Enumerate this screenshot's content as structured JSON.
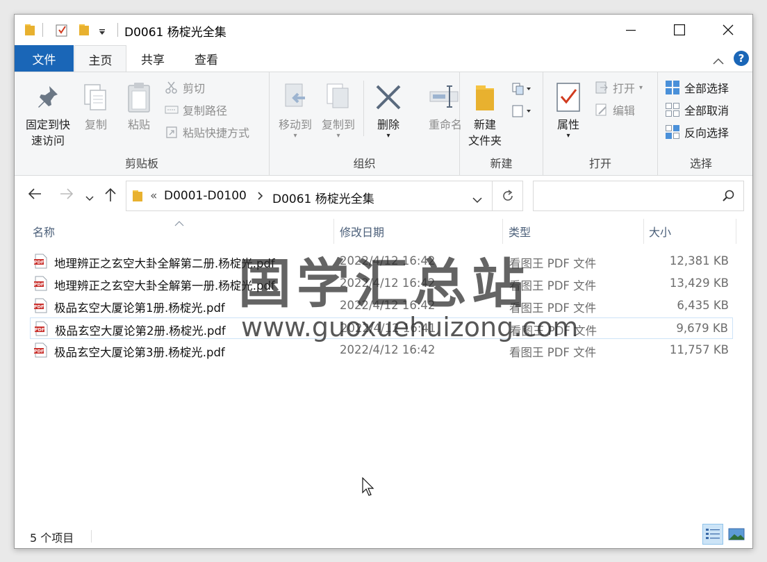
{
  "window": {
    "title": "D0061 杨椗光全集"
  },
  "ribbon_tabs": {
    "file": "文件",
    "home": "主页",
    "share": "共享",
    "view": "查看"
  },
  "clipboard": {
    "pin": "固定到快",
    "pin2": "速访问",
    "copy": "复制",
    "paste": "粘贴",
    "cut": "剪切",
    "copy_path": "复制路径",
    "paste_shortcut": "粘贴快捷方式",
    "label": "剪贴板"
  },
  "organize": {
    "move_to": "移动到",
    "copy_to": "复制到",
    "delete": "删除",
    "rename": "重命名",
    "label": "组织"
  },
  "new_group": {
    "new_folder": "新建",
    "new_folder2": "文件夹",
    "label": "新建"
  },
  "open_group": {
    "properties": "属性",
    "open": "打开",
    "edit": "编辑",
    "label": "打开"
  },
  "select_group": {
    "select_all": "全部选择",
    "select_none": "全部取消",
    "invert": "反向选择",
    "label": "选择"
  },
  "address": {
    "prefix": "«",
    "crumb1": "D0001-D0100",
    "crumb2": "D0061 杨椗光全集",
    "search_placeholder": ""
  },
  "columns": {
    "name": "名称",
    "date": "修改日期",
    "type": "类型",
    "size": "大小"
  },
  "files": [
    {
      "name": "地理辨正之玄空大卦全解第二册.杨椗光.pdf",
      "date": "2022/4/12 16:42",
      "type": "看图王 PDF 文件",
      "size": "12,381 KB"
    },
    {
      "name": "地理辨正之玄空大卦全解第一册.杨椗光.pdf",
      "date": "2022/4/12 16:42",
      "type": "看图王 PDF 文件",
      "size": "13,429 KB"
    },
    {
      "name": "极品玄空大厦论第1册.杨椗光.pdf",
      "date": "2022/4/12 16:42",
      "type": "看图王 PDF 文件",
      "size": "6,435 KB"
    },
    {
      "name": "极品玄空大厦论第2册.杨椗光.pdf",
      "date": "2022/4/12 16:41",
      "type": "看图王 PDF 文件",
      "size": "9,679 KB"
    },
    {
      "name": "极品玄空大厦论第3册.杨椗光.pdf",
      "date": "2022/4/12 16:42",
      "type": "看图王 PDF 文件",
      "size": "11,757 KB"
    }
  ],
  "status": {
    "count": "5 个项目"
  },
  "watermark": {
    "cn": "国学汇总站",
    "url": "www.guoxuehuizong.com"
  },
  "colors": {
    "accent": "#1a66b7",
    "folder": "#f5c342",
    "selection_border": "#cde3f7"
  }
}
